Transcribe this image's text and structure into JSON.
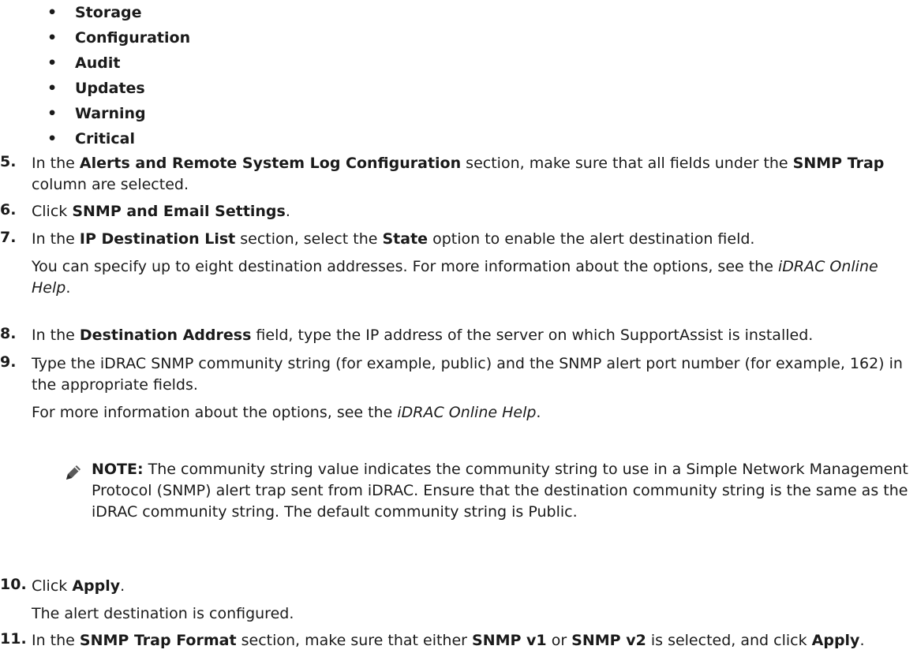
{
  "bullets": [
    "Storage",
    "Configuration",
    "Audit",
    "Updates",
    "Warning",
    "Critical"
  ],
  "steps": {
    "s5": {
      "num": "5.",
      "t1": "In the ",
      "b1": "Alerts and Remote System Log Configuration",
      "t2": " section, make sure that all fields under the ",
      "b2": "SNMP Trap",
      "t3": " column are selected."
    },
    "s6": {
      "num": "6.",
      "t1": "Click ",
      "b1": "SNMP and Email Settings",
      "t2": "."
    },
    "s7": {
      "num": "7.",
      "t1": "In the ",
      "b1": "IP Destination List",
      "t2": " section, select the ",
      "b2": "State",
      "t3": " option to enable the alert destination field.",
      "p2a": "You can specify up to eight destination addresses. For more information about the options, see the ",
      "p2i": "iDRAC Online Help",
      "p2b": "."
    },
    "s8": {
      "num": "8.",
      "t1": "In the ",
      "b1": "Destination Address",
      "t2": " field, type the IP address of the server on which SupportAssist is installed."
    },
    "s9": {
      "num": "9.",
      "t1": "Type the iDRAC SNMP community string (for example, public) and the SNMP alert port number (for example, 162) in the appropriate fields.",
      "p2a": "For more information about the options, see the ",
      "p2i": "iDRAC Online Help",
      "p2b": "."
    },
    "note": {
      "label": "NOTE:",
      "text": " The community string value indicates the community string to use in a Simple Network Management Protocol (SNMP) alert trap sent from iDRAC. Ensure that the destination community string is the same as the iDRAC community string. The default community string is Public."
    },
    "s10": {
      "num": "10.",
      "t1": "Click ",
      "b1": "Apply",
      "t2": ".",
      "p2": "The alert destination is configured."
    },
    "s11": {
      "num": "11.",
      "t1": "In the ",
      "b1": "SNMP Trap Format",
      "t2": " section, make sure that either ",
      "b2": "SNMP v1",
      "t3": " or ",
      "b3": "SNMP v2",
      "t4": " is selected, and click ",
      "b4": "Apply",
      "t5": "."
    }
  }
}
